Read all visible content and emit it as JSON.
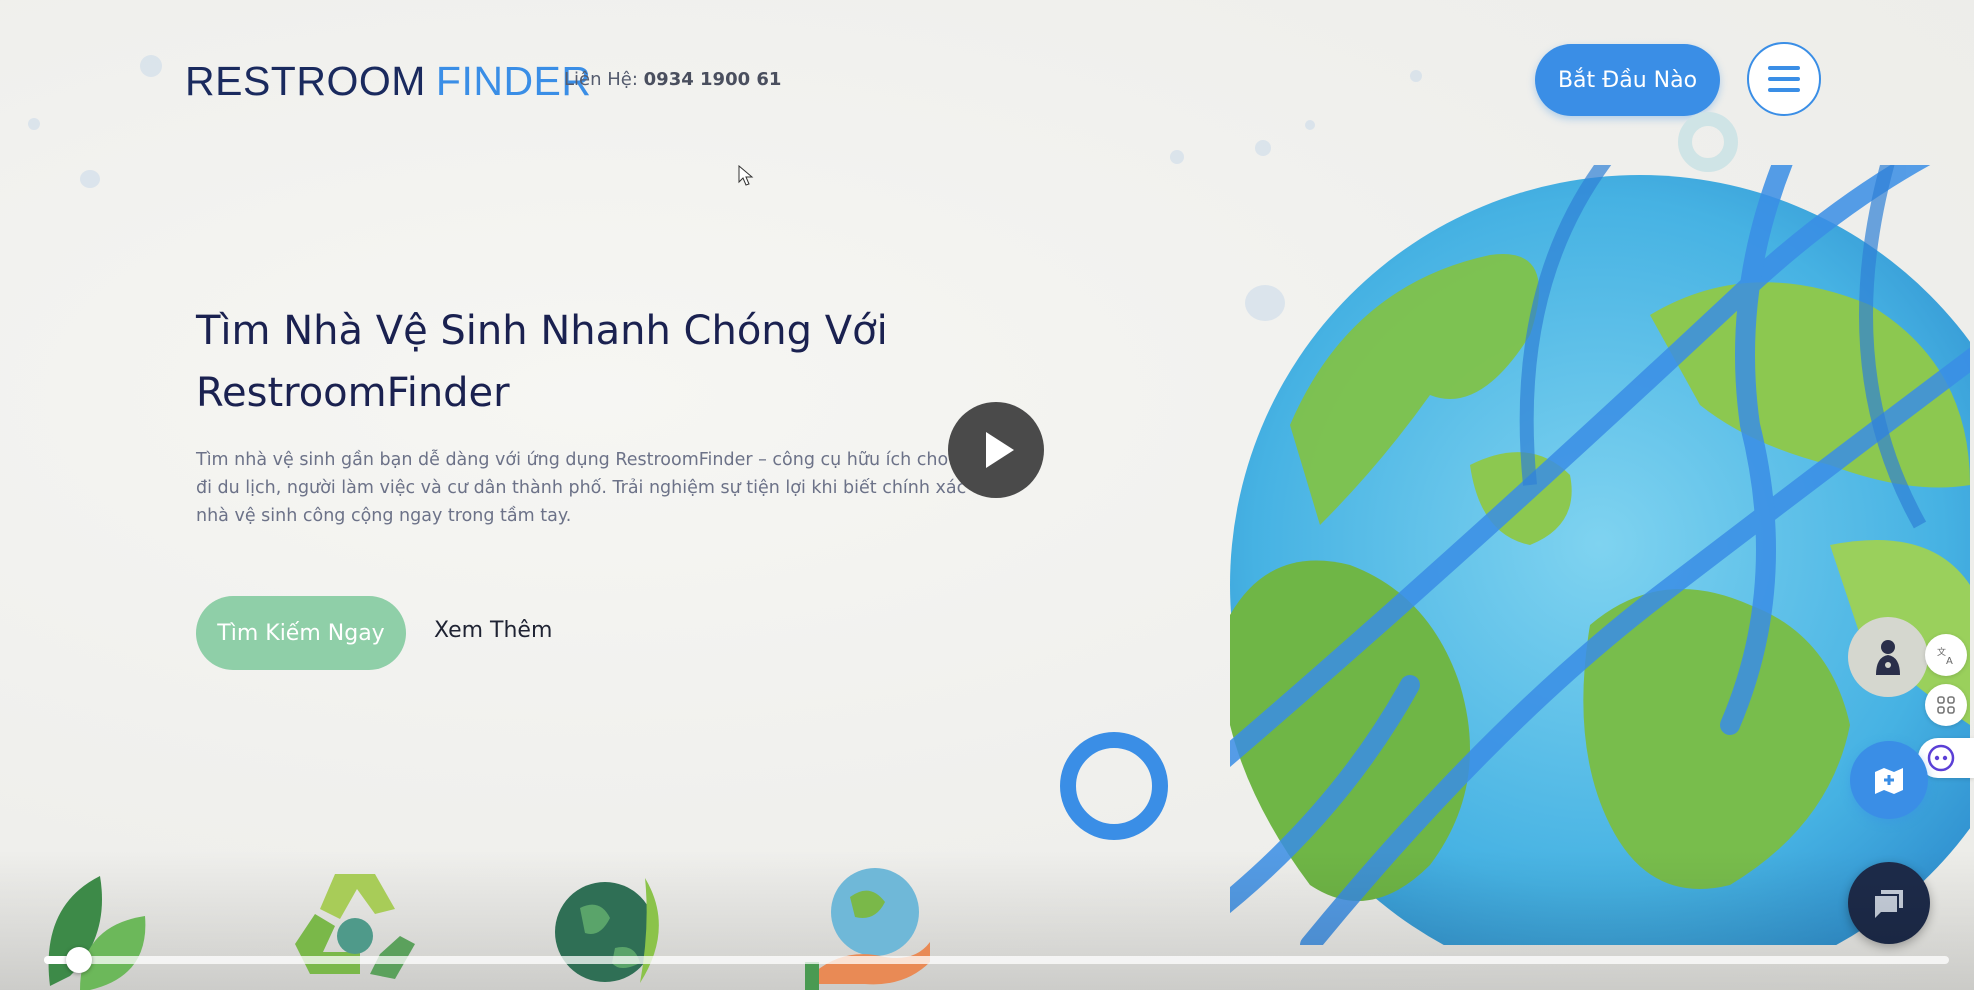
{
  "header": {
    "logo_part1": "RESTROOM",
    "logo_part2": "FINDER",
    "contact_label": "Liên Hệ:",
    "contact_phone": "0934 1900 61",
    "start_button": "Bắt Đầu Nào",
    "menu_icon": "hamburger-menu-icon"
  },
  "hero": {
    "title_line1": "Tìm Nhà Vệ Sinh Nhanh Chóng Với",
    "title_line2": "RestroomFinder",
    "description": "Tìm nhà vệ sinh gần bạn dễ dàng với ứng dụng RestroomFinder – công cụ hữu ích cho người đi du lịch, người làm việc và cư dân thành phố. Trải nghiệm sự tiện lợi khi biết chính xác vị trí nhà vệ sinh công cộng ngay trong tầm tay.",
    "primary_button": "Tìm Kiếm Ngay",
    "secondary_link": "Xem Thêm"
  },
  "video": {
    "play_icon": "play-icon",
    "progress": 0.015
  },
  "icons": {
    "leaf": "leaf-icon",
    "recycle": "recycle-icon",
    "globe_leaf": "globe-leaf-icon",
    "hand_earth": "hand-earth-icon",
    "translate": "translate-icon",
    "apps": "apps-grid-icon",
    "assistant": "assistant-icon",
    "chat": "chat-icon"
  },
  "colors": {
    "brand_dark": "#1a2a5e",
    "brand_blue": "#3a8ee6",
    "accent_green": "#8fcfa8",
    "background": "#f1f1ee"
  }
}
